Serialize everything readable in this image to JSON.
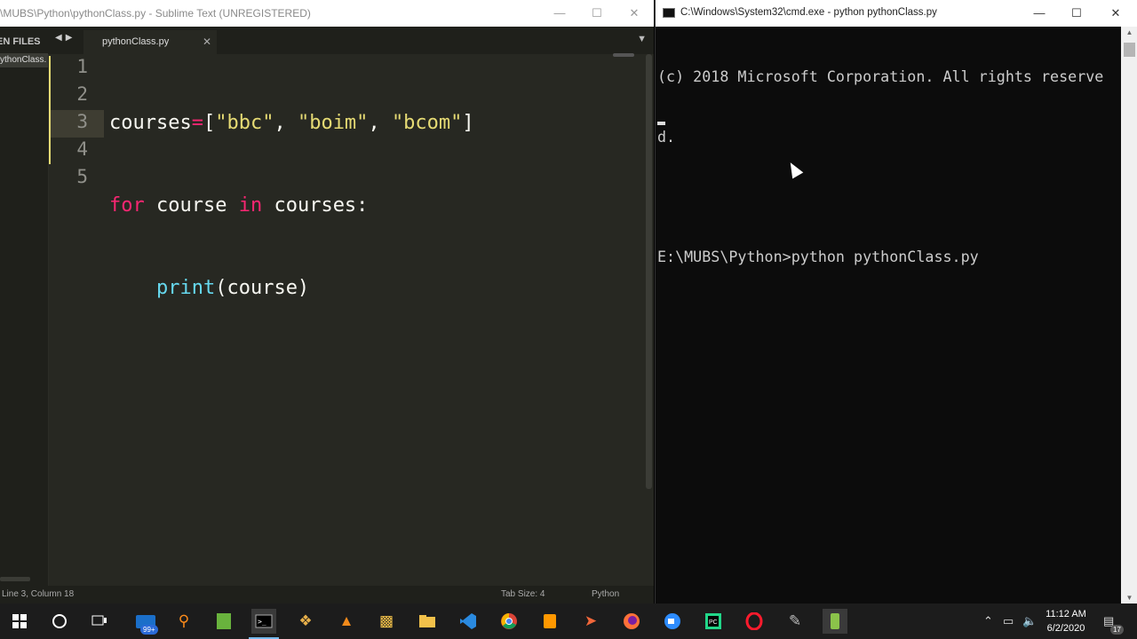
{
  "sublime": {
    "title": "\\MUBS\\Python\\pythonClass.py - Sublime Text (UNREGISTERED)",
    "sidebar_header": "EN FILES",
    "sidebar_file": "ythonClass.",
    "tab_label": "pythonClass.py",
    "line_numbers": [
      "1",
      "2",
      "3",
      "4",
      "5"
    ],
    "code": {
      "l1_ident": "courses",
      "l1_op": "=",
      "l1_open": "[",
      "l1_s1": "\"bbc\"",
      "l1_c1": ", ",
      "l1_s2": "\"boim\"",
      "l1_c2": ", ",
      "l1_s3": "\"bcom\"",
      "l1_close": "]",
      "l2_for": "for",
      "l2_var": " course ",
      "l2_in": "in",
      "l2_rest": " courses:",
      "l3_indent": "    ",
      "l3_fn": "print",
      "l3_rest": "(course)"
    },
    "status": {
      "position": "Line 3, Column 18",
      "tab_size": "Tab Size: 4",
      "syntax": "Python"
    }
  },
  "cmd": {
    "title": "C:\\Windows\\System32\\cmd.exe - python  pythonClass.py",
    "lines": [
      "(c) 2018 Microsoft Corporation. All rights reserve",
      "d.",
      "",
      "E:\\MUBS\\Python>python pythonClass.py"
    ]
  },
  "taskbar": {
    "badge_count": "99+",
    "clock_time": "11:12 AM",
    "clock_date": "6/2/2020",
    "notification_count": "17"
  },
  "colors": {
    "editor_bg": "#272822",
    "keyword": "#f92672",
    "string": "#e6db74",
    "function": "#66d9ef",
    "taskbar_accent": "#76b9ed"
  }
}
